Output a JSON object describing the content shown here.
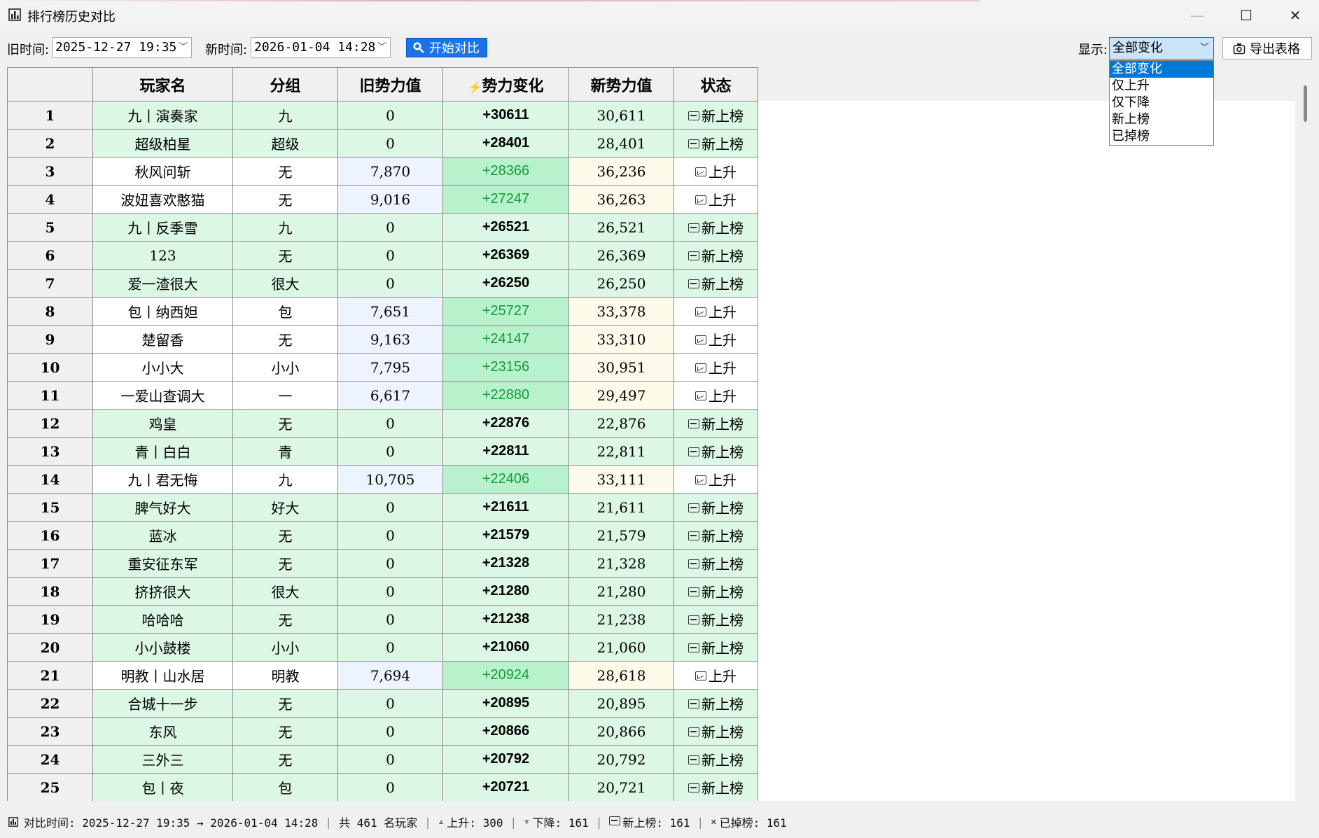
{
  "window": {
    "title": "排行榜历史对比",
    "minimize": "—",
    "maximize": "☐",
    "close": "✕"
  },
  "toolbar": {
    "old_time_label": "旧时间:",
    "old_time_value": "2025-12-27 19:35",
    "new_time_label": "新时间:",
    "new_time_value": "2026-01-04 14:28",
    "start_button": "开始对比",
    "show_label": "显示:",
    "show_value": "全部变化",
    "export_button": "导出表格"
  },
  "filter_options": [
    "全部变化",
    "仅上升",
    "仅下降",
    "新上榜",
    "已掉榜"
  ],
  "table": {
    "headers": [
      "",
      "玩家名",
      "分组",
      "旧势力值",
      "势力变化",
      "新势力值",
      "状态"
    ],
    "change_header_icon": "lightning-icon",
    "rows": [
      {
        "n": "1",
        "name": "九丨演奏家",
        "group": "九",
        "old": "0",
        "change": "+30611",
        "new": "30,611",
        "status": "新上榜",
        "kind": "new"
      },
      {
        "n": "2",
        "name": "超级柏星",
        "group": "超级",
        "old": "0",
        "change": "+28401",
        "new": "28,401",
        "status": "新上榜",
        "kind": "new"
      },
      {
        "n": "3",
        "name": "秋风问斩",
        "group": "无",
        "old": "7,870",
        "change": "+28366",
        "new": "36,236",
        "status": "上升",
        "kind": "up"
      },
      {
        "n": "4",
        "name": "波妞喜欢憨猫",
        "group": "无",
        "old": "9,016",
        "change": "+27247",
        "new": "36,263",
        "status": "上升",
        "kind": "up"
      },
      {
        "n": "5",
        "name": "九丨反季雪",
        "group": "九",
        "old": "0",
        "change": "+26521",
        "new": "26,521",
        "status": "新上榜",
        "kind": "new"
      },
      {
        "n": "6",
        "name": "123",
        "group": "无",
        "old": "0",
        "change": "+26369",
        "new": "26,369",
        "status": "新上榜",
        "kind": "new"
      },
      {
        "n": "7",
        "name": "爱一渣很大",
        "group": "很大",
        "old": "0",
        "change": "+26250",
        "new": "26,250",
        "status": "新上榜",
        "kind": "new"
      },
      {
        "n": "8",
        "name": "包丨纳西妲",
        "group": "包",
        "old": "7,651",
        "change": "+25727",
        "new": "33,378",
        "status": "上升",
        "kind": "up"
      },
      {
        "n": "9",
        "name": "楚留香",
        "group": "无",
        "old": "9,163",
        "change": "+24147",
        "new": "33,310",
        "status": "上升",
        "kind": "up"
      },
      {
        "n": "10",
        "name": "小小大",
        "group": "小小",
        "old": "7,795",
        "change": "+23156",
        "new": "30,951",
        "status": "上升",
        "kind": "up"
      },
      {
        "n": "11",
        "name": "一爱山查调大",
        "group": "一",
        "old": "6,617",
        "change": "+22880",
        "new": "29,497",
        "status": "上升",
        "kind": "up"
      },
      {
        "n": "12",
        "name": "鸡皇",
        "group": "无",
        "old": "0",
        "change": "+22876",
        "new": "22,876",
        "status": "新上榜",
        "kind": "new"
      },
      {
        "n": "13",
        "name": "青丨白白",
        "group": "青",
        "old": "0",
        "change": "+22811",
        "new": "22,811",
        "status": "新上榜",
        "kind": "new"
      },
      {
        "n": "14",
        "name": "九丨君无悔",
        "group": "九",
        "old": "10,705",
        "change": "+22406",
        "new": "33,111",
        "status": "上升",
        "kind": "up"
      },
      {
        "n": "15",
        "name": "脾气好大",
        "group": "好大",
        "old": "0",
        "change": "+21611",
        "new": "21,611",
        "status": "新上榜",
        "kind": "new"
      },
      {
        "n": "16",
        "name": "蓝冰",
        "group": "无",
        "old": "0",
        "change": "+21579",
        "new": "21,579",
        "status": "新上榜",
        "kind": "new"
      },
      {
        "n": "17",
        "name": "重安征东军",
        "group": "无",
        "old": "0",
        "change": "+21328",
        "new": "21,328",
        "status": "新上榜",
        "kind": "new"
      },
      {
        "n": "18",
        "name": "挤挤很大",
        "group": "很大",
        "old": "0",
        "change": "+21280",
        "new": "21,280",
        "status": "新上榜",
        "kind": "new"
      },
      {
        "n": "19",
        "name": "哈哈哈",
        "group": "无",
        "old": "0",
        "change": "+21238",
        "new": "21,238",
        "status": "新上榜",
        "kind": "new"
      },
      {
        "n": "20",
        "name": "小小鼓楼",
        "group": "小小",
        "old": "0",
        "change": "+21060",
        "new": "21,060",
        "status": "新上榜",
        "kind": "new"
      },
      {
        "n": "21",
        "name": "明教丨山水居",
        "group": "明教",
        "old": "7,694",
        "change": "+20924",
        "new": "28,618",
        "status": "上升",
        "kind": "up"
      },
      {
        "n": "22",
        "name": "合城十一步",
        "group": "无",
        "old": "0",
        "change": "+20895",
        "new": "20,895",
        "status": "新上榜",
        "kind": "new"
      },
      {
        "n": "23",
        "name": "东风",
        "group": "无",
        "old": "0",
        "change": "+20866",
        "new": "20,866",
        "status": "新上榜",
        "kind": "new"
      },
      {
        "n": "24",
        "name": "三外三",
        "group": "无",
        "old": "0",
        "change": "+20792",
        "new": "20,792",
        "status": "新上榜",
        "kind": "new"
      },
      {
        "n": "25",
        "name": "包丨夜",
        "group": "包",
        "old": "0",
        "change": "+20721",
        "new": "20,721",
        "status": "新上榜",
        "kind": "new"
      }
    ]
  },
  "status_bar": {
    "compare_time": "对比时间: 2025-12-27 19:35 → 2026-01-04 14:28",
    "total": "共 461 名玩家",
    "up": "上升: 300",
    "down": "下降: 161",
    "new": "新上榜: 161",
    "dropped": "已掉榜: 161"
  },
  "colors": {
    "accent": "#1a73e8",
    "new_row": "#dcf8e4",
    "up_change": "#b8f2cc",
    "up_text": "#159a3a"
  }
}
